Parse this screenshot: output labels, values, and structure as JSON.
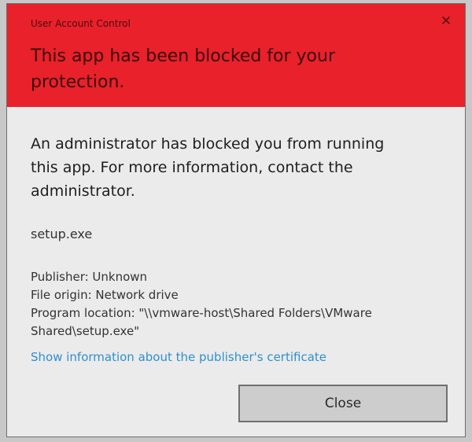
{
  "dialog": {
    "window_title": "User Account Control",
    "close_glyph": "✕",
    "headline": "This app has been blocked for your protection.",
    "message": "An administrator has blocked you from running this app. For more information, contact the administrator.",
    "program_name": "setup.exe",
    "publisher": "Publisher: Unknown",
    "file_origin": "File origin: Network drive",
    "program_location_line1": "Program location: \"\\\\vmware-host\\Shared Folders\\VMware",
    "program_location_line2": "Shared\\setup.exe\"",
    "certificate_link": "Show information about the publisher's certificate",
    "close_button_label": "Close"
  },
  "colors": {
    "header_red": "#e8212b",
    "body_background": "#ebebeb",
    "link_blue": "#2e8fd0"
  },
  "icons": {
    "close": "close-icon"
  }
}
